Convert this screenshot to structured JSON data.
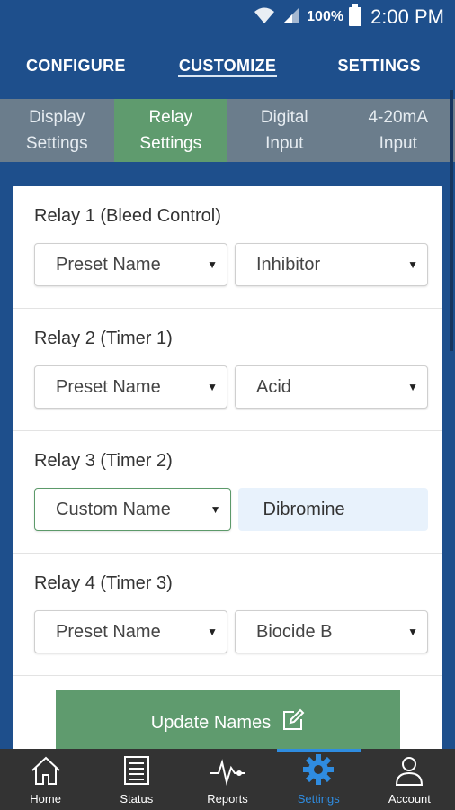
{
  "status_bar": {
    "battery": "100%",
    "time": "2:00 PM"
  },
  "top_nav": {
    "tabs": [
      {
        "label": "CONFIGURE"
      },
      {
        "label": "CUSTOMIZE",
        "active": true
      },
      {
        "label": "SETTINGS"
      }
    ]
  },
  "sub_tabs": [
    {
      "label": "Display\nSettings"
    },
    {
      "label": "Relay\nSettings",
      "active": true
    },
    {
      "label": "Digital\nInput"
    },
    {
      "label": "4-20mA\nInput"
    }
  ],
  "relays": [
    {
      "title": "Relay 1 (Bleed Control)",
      "name_type": "Preset Name",
      "value": "Inhibitor"
    },
    {
      "title": "Relay 2 (Timer 1)",
      "name_type": "Preset Name",
      "value": "Acid"
    },
    {
      "title": "Relay 3 (Timer 2)",
      "name_type": "Custom Name",
      "value": "Dibromine"
    },
    {
      "title": "Relay 4 (Timer 3)",
      "name_type": "Preset Name",
      "value": "Biocide B"
    }
  ],
  "update_button": {
    "label": "Update Names",
    "icon": "edit-icon"
  },
  "bottom_nav": [
    {
      "label": "Home",
      "icon": "home-icon"
    },
    {
      "label": "Status",
      "icon": "status-icon"
    },
    {
      "label": "Reports",
      "icon": "pulse-icon"
    },
    {
      "label": "Settings",
      "icon": "gear-icon",
      "active": true
    },
    {
      "label": "Account",
      "icon": "person-icon"
    }
  ],
  "colors": {
    "header": "#1e4f8c",
    "accent_green": "#5f9b6e",
    "subtab_bg": "#6b7d8c",
    "active_nav": "#2f8ce0",
    "bottom_nav": "#333333"
  }
}
